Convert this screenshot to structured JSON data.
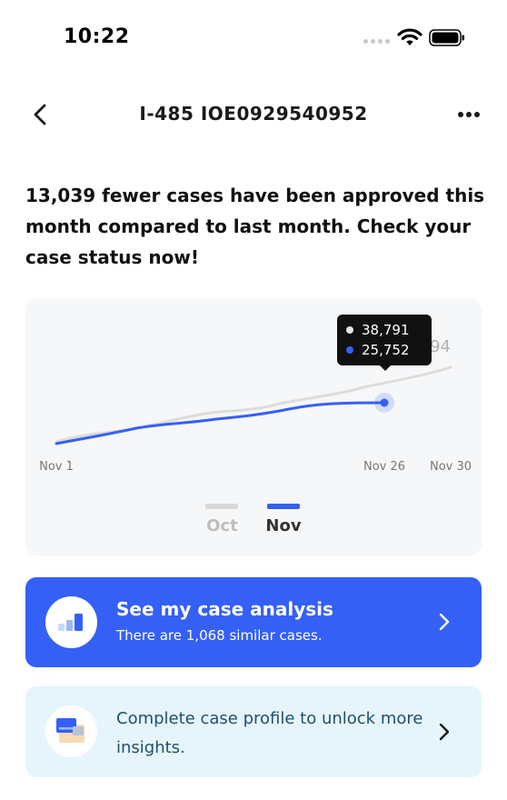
{
  "status_bar": {
    "time": "10:22"
  },
  "nav": {
    "title": "I-485 IOE0929540952"
  },
  "headline": "13,039 fewer cases have been approved this month compared to last month. Check your case status now!",
  "chart": {
    "tooltip": {
      "oct_value": "38,791",
      "nov_value": "25,752"
    },
    "partial_label": "94",
    "x_ticks": [
      "Nov 1",
      "Nov 26",
      "Nov 30"
    ],
    "legend": [
      {
        "label": "Oct",
        "color": "#d9d9d9"
      },
      {
        "label": "Nov",
        "color": "#3560f6"
      }
    ]
  },
  "chart_data": {
    "type": "line",
    "x": [
      "Nov 1",
      "Nov 26",
      "Nov 30"
    ],
    "series": [
      {
        "name": "Oct",
        "color": "#d9d9d9",
        "values": [
          2200,
          38791,
          null
        ]
      },
      {
        "name": "Nov",
        "color": "#3560f6",
        "values": [
          1800,
          25752,
          null
        ]
      }
    ],
    "title": "",
    "xlabel": "",
    "ylabel": ""
  },
  "analysis_card": {
    "title": "See my case analysis",
    "subtitle": "There are 1,068 similar cases.",
    "accent": "#3560f6"
  },
  "profile_card": {
    "text": "Complete case profile to unlock more insights."
  },
  "icons": {
    "back": "chevron-left-icon",
    "more": "more-horizontal-icon",
    "analysis": "bar-chart-icon",
    "profile": "folder-profile-icon",
    "chevron": "chevron-right-icon"
  }
}
